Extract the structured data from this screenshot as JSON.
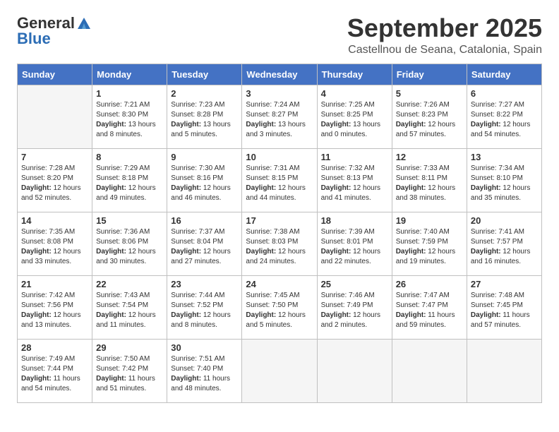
{
  "header": {
    "logo_general": "General",
    "logo_blue": "Blue",
    "month": "September 2025",
    "location": "Castellnou de Seana, Catalonia, Spain"
  },
  "weekdays": [
    "Sunday",
    "Monday",
    "Tuesday",
    "Wednesday",
    "Thursday",
    "Friday",
    "Saturday"
  ],
  "weeks": [
    [
      {
        "day": "",
        "sunrise": "",
        "sunset": "",
        "daylight": ""
      },
      {
        "day": "1",
        "sunrise": "7:21 AM",
        "sunset": "8:30 PM",
        "daylight": "13 hours and 8 minutes."
      },
      {
        "day": "2",
        "sunrise": "7:23 AM",
        "sunset": "8:28 PM",
        "daylight": "13 hours and 5 minutes."
      },
      {
        "day": "3",
        "sunrise": "7:24 AM",
        "sunset": "8:27 PM",
        "daylight": "13 hours and 3 minutes."
      },
      {
        "day": "4",
        "sunrise": "7:25 AM",
        "sunset": "8:25 PM",
        "daylight": "13 hours and 0 minutes."
      },
      {
        "day": "5",
        "sunrise": "7:26 AM",
        "sunset": "8:23 PM",
        "daylight": "12 hours and 57 minutes."
      },
      {
        "day": "6",
        "sunrise": "7:27 AM",
        "sunset": "8:22 PM",
        "daylight": "12 hours and 54 minutes."
      }
    ],
    [
      {
        "day": "7",
        "sunrise": "7:28 AM",
        "sunset": "8:20 PM",
        "daylight": "12 hours and 52 minutes."
      },
      {
        "day": "8",
        "sunrise": "7:29 AM",
        "sunset": "8:18 PM",
        "daylight": "12 hours and 49 minutes."
      },
      {
        "day": "9",
        "sunrise": "7:30 AM",
        "sunset": "8:16 PM",
        "daylight": "12 hours and 46 minutes."
      },
      {
        "day": "10",
        "sunrise": "7:31 AM",
        "sunset": "8:15 PM",
        "daylight": "12 hours and 44 minutes."
      },
      {
        "day": "11",
        "sunrise": "7:32 AM",
        "sunset": "8:13 PM",
        "daylight": "12 hours and 41 minutes."
      },
      {
        "day": "12",
        "sunrise": "7:33 AM",
        "sunset": "8:11 PM",
        "daylight": "12 hours and 38 minutes."
      },
      {
        "day": "13",
        "sunrise": "7:34 AM",
        "sunset": "8:10 PM",
        "daylight": "12 hours and 35 minutes."
      }
    ],
    [
      {
        "day": "14",
        "sunrise": "7:35 AM",
        "sunset": "8:08 PM",
        "daylight": "12 hours and 33 minutes."
      },
      {
        "day": "15",
        "sunrise": "7:36 AM",
        "sunset": "8:06 PM",
        "daylight": "12 hours and 30 minutes."
      },
      {
        "day": "16",
        "sunrise": "7:37 AM",
        "sunset": "8:04 PM",
        "daylight": "12 hours and 27 minutes."
      },
      {
        "day": "17",
        "sunrise": "7:38 AM",
        "sunset": "8:03 PM",
        "daylight": "12 hours and 24 minutes."
      },
      {
        "day": "18",
        "sunrise": "7:39 AM",
        "sunset": "8:01 PM",
        "daylight": "12 hours and 22 minutes."
      },
      {
        "day": "19",
        "sunrise": "7:40 AM",
        "sunset": "7:59 PM",
        "daylight": "12 hours and 19 minutes."
      },
      {
        "day": "20",
        "sunrise": "7:41 AM",
        "sunset": "7:57 PM",
        "daylight": "12 hours and 16 minutes."
      }
    ],
    [
      {
        "day": "21",
        "sunrise": "7:42 AM",
        "sunset": "7:56 PM",
        "daylight": "12 hours and 13 minutes."
      },
      {
        "day": "22",
        "sunrise": "7:43 AM",
        "sunset": "7:54 PM",
        "daylight": "12 hours and 11 minutes."
      },
      {
        "day": "23",
        "sunrise": "7:44 AM",
        "sunset": "7:52 PM",
        "daylight": "12 hours and 8 minutes."
      },
      {
        "day": "24",
        "sunrise": "7:45 AM",
        "sunset": "7:50 PM",
        "daylight": "12 hours and 5 minutes."
      },
      {
        "day": "25",
        "sunrise": "7:46 AM",
        "sunset": "7:49 PM",
        "daylight": "12 hours and 2 minutes."
      },
      {
        "day": "26",
        "sunrise": "7:47 AM",
        "sunset": "7:47 PM",
        "daylight": "11 hours and 59 minutes."
      },
      {
        "day": "27",
        "sunrise": "7:48 AM",
        "sunset": "7:45 PM",
        "daylight": "11 hours and 57 minutes."
      }
    ],
    [
      {
        "day": "28",
        "sunrise": "7:49 AM",
        "sunset": "7:44 PM",
        "daylight": "11 hours and 54 minutes."
      },
      {
        "day": "29",
        "sunrise": "7:50 AM",
        "sunset": "7:42 PM",
        "daylight": "11 hours and 51 minutes."
      },
      {
        "day": "30",
        "sunrise": "7:51 AM",
        "sunset": "7:40 PM",
        "daylight": "11 hours and 48 minutes."
      },
      {
        "day": "",
        "sunrise": "",
        "sunset": "",
        "daylight": ""
      },
      {
        "day": "",
        "sunrise": "",
        "sunset": "",
        "daylight": ""
      },
      {
        "day": "",
        "sunrise": "",
        "sunset": "",
        "daylight": ""
      },
      {
        "day": "",
        "sunrise": "",
        "sunset": "",
        "daylight": ""
      }
    ]
  ],
  "labels": {
    "sunrise": "Sunrise: ",
    "sunset": "Sunset: ",
    "daylight": "Daylight: "
  }
}
